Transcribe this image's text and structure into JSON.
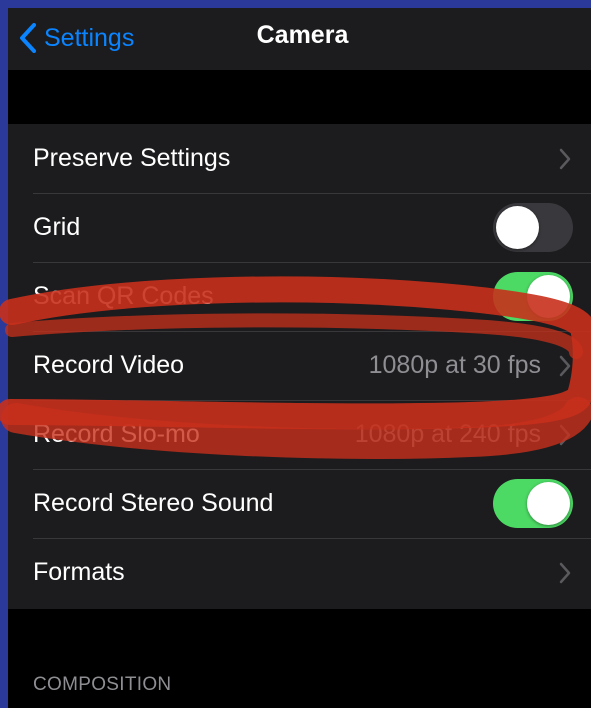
{
  "navbar": {
    "back_label": "Settings",
    "title": "Camera"
  },
  "rows": [
    {
      "label": "Preserve Settings",
      "value": "",
      "control": "chevron"
    },
    {
      "label": "Grid",
      "value": "",
      "control": "toggle",
      "state": "off"
    },
    {
      "label": "Scan QR Codes",
      "value": "",
      "control": "toggle",
      "state": "on"
    },
    {
      "label": "Record Video",
      "value": "1080p at 30 fps",
      "control": "chevron"
    },
    {
      "label": "Record Slo-mo",
      "value": "1080p at 240 fps",
      "control": "chevron"
    },
    {
      "label": "Record Stereo Sound",
      "value": "",
      "control": "toggle",
      "state": "on"
    },
    {
      "label": "Formats",
      "value": "",
      "control": "chevron"
    }
  ],
  "section_header": "COMPOSITION",
  "colors": {
    "accent": "#0a84ff",
    "toggle_on": "#4cd964",
    "toggle_off": "#39393d",
    "annotation": "#d6301c"
  }
}
